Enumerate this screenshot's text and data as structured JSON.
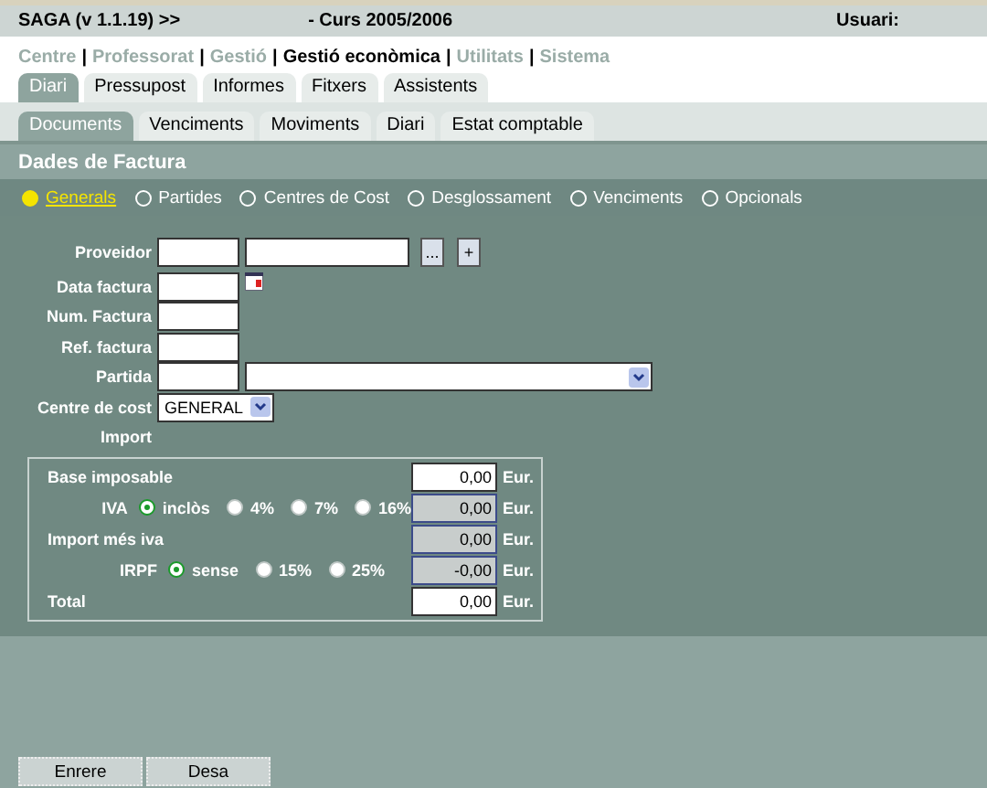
{
  "header": {
    "app": "SAGA (v 1.1.19) >>",
    "course": "- Curs 2005/2006",
    "user": "Usuari:"
  },
  "nav": {
    "separator": "|",
    "items": [
      {
        "label": "Centre",
        "selected": false
      },
      {
        "label": "Professorat",
        "selected": false
      },
      {
        "label": "Gestió",
        "selected": false
      },
      {
        "label": "Gestió econòmica",
        "selected": true
      },
      {
        "label": "Utilitats",
        "selected": false
      },
      {
        "label": "Sistema",
        "selected": false
      }
    ]
  },
  "tabs": [
    {
      "label": "Diari",
      "selected": true
    },
    {
      "label": "Pressupost",
      "selected": false
    },
    {
      "label": "Informes",
      "selected": false
    },
    {
      "label": "Fitxers",
      "selected": false
    },
    {
      "label": "Assistents",
      "selected": false
    }
  ],
  "subtabs": [
    {
      "label": "Documents",
      "selected": true
    },
    {
      "label": "Venciments",
      "selected": false
    },
    {
      "label": "Moviments",
      "selected": false
    },
    {
      "label": "Diari",
      "selected": false
    },
    {
      "label": "Estat comptable",
      "selected": false
    }
  ],
  "title": "Dades de Factura",
  "sections": [
    {
      "label": "Generals",
      "selected": true
    },
    {
      "label": "Partides",
      "selected": false
    },
    {
      "label": "Centres de Cost",
      "selected": false
    },
    {
      "label": "Desglossament",
      "selected": false
    },
    {
      "label": "Venciments",
      "selected": false
    },
    {
      "label": "Opcionals",
      "selected": false
    }
  ],
  "fields": [
    {
      "label": "Proveidor",
      "kind": "lookup",
      "browse_button": "...",
      "add_button": "+"
    },
    {
      "label": "Data factura",
      "kind": "date"
    },
    {
      "label": "Num. Factura",
      "kind": "text"
    },
    {
      "label": "Ref. factura",
      "kind": "text"
    },
    {
      "label": "Partida",
      "kind": "code-select"
    },
    {
      "label": "Centre de cost",
      "kind": "select",
      "value": "GENERAL"
    }
  ],
  "import": {
    "label": "Import",
    "rows": [
      {
        "label": "Base imposable",
        "value": "0,00",
        "unit": "Eur.",
        "disabled": false,
        "options": []
      },
      {
        "label": "IVA",
        "value": "0,00",
        "unit": "Eur.",
        "disabled": true,
        "options": [
          {
            "label": "inclòs",
            "selected": true
          },
          {
            "label": "4%",
            "selected": false
          },
          {
            "label": "7%",
            "selected": false
          },
          {
            "label": "16%",
            "selected": false
          }
        ]
      },
      {
        "label": "Import més iva",
        "value": "0,00",
        "unit": "Eur.",
        "disabled": true,
        "options": []
      },
      {
        "label": "IRPF",
        "value": "-0,00",
        "unit": "Eur.",
        "disabled": true,
        "options": [
          {
            "label": "sense",
            "selected": true
          },
          {
            "label": "15%",
            "selected": false
          },
          {
            "label": "25%",
            "selected": false
          }
        ]
      },
      {
        "label": "Total",
        "value": "0,00",
        "unit": "Eur.",
        "disabled": false,
        "options": []
      }
    ]
  },
  "buttons": [
    "Enrere",
    "Desa"
  ]
}
